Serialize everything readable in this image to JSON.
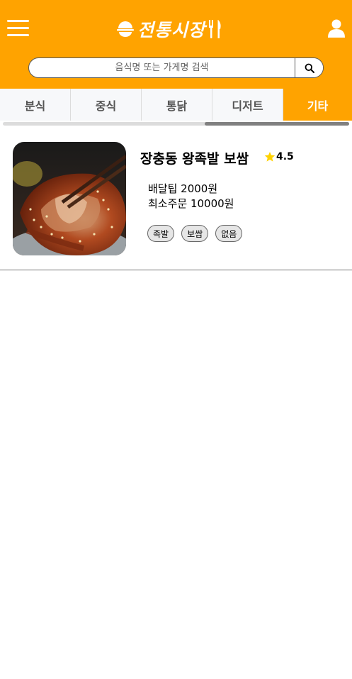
{
  "header": {
    "logo_text": "전통시장",
    "background_color": "#ffa300"
  },
  "search": {
    "placeholder": "음식명 또는 가게명 검색",
    "value": ""
  },
  "tabs": [
    {
      "label": "분식",
      "active": false
    },
    {
      "label": "중식",
      "active": false
    },
    {
      "label": "통닭",
      "active": false
    },
    {
      "label": "디저트",
      "active": false
    },
    {
      "label": "기타",
      "active": true
    }
  ],
  "stores": [
    {
      "name": "장충동 왕족발 보쌈",
      "rating": "4.5",
      "delivery_tip": "배달팁 2000원",
      "min_order": "최소주문 10000원",
      "tags": [
        "족발",
        "보쌈",
        "없음"
      ]
    }
  ],
  "icons": {
    "menu": "hamburger-icon",
    "user": "user-icon",
    "search": "magnifier-icon",
    "rating": "star-icon"
  },
  "colors": {
    "accent": "#ffa300",
    "star": "#ffd200"
  }
}
